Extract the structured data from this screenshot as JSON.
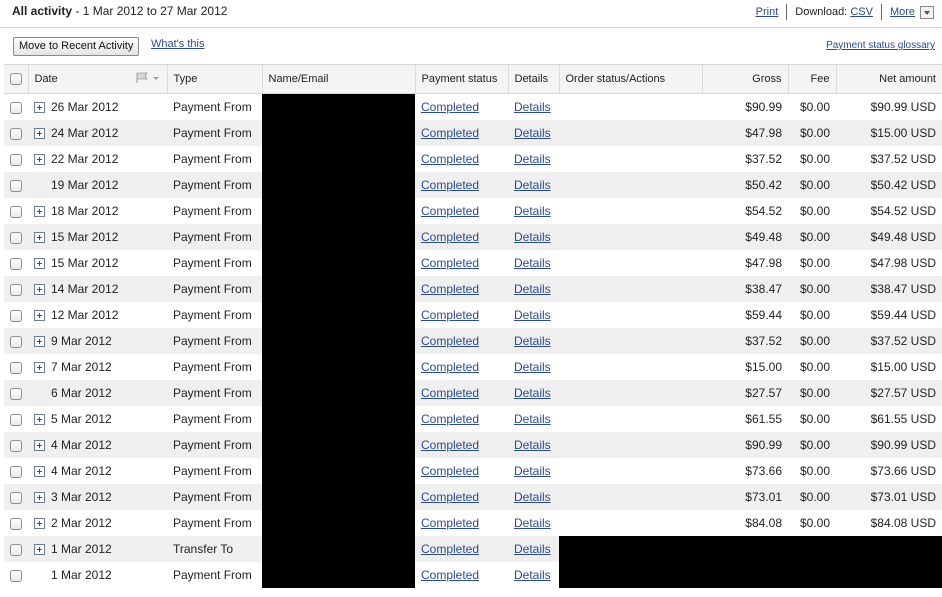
{
  "header": {
    "title_bold": "All activity",
    "title_range": " - 1 Mar 2012 to 27 Mar 2012",
    "print": "Print",
    "download_label": "Download:",
    "csv": "CSV",
    "more": "More"
  },
  "toolbar": {
    "move_button": "Move to Recent Activity",
    "whats_this": "What's this",
    "glossary": "Payment status glossary"
  },
  "columns": {
    "date": "Date",
    "type": "Type",
    "name": "Name/Email",
    "status": "Payment status",
    "details": "Details",
    "order": "Order status/Actions",
    "gross": "Gross",
    "fee": "Fee",
    "net": "Net amount"
  },
  "rows": [
    {
      "date": "26 Mar 2012",
      "expand": true,
      "type": "Payment From",
      "status": "Completed",
      "details": "Details",
      "gross": "$90.99",
      "fee": "$0.00",
      "net": "$90.99 USD"
    },
    {
      "date": "24 Mar 2012",
      "expand": true,
      "type": "Payment From",
      "status": "Completed",
      "details": "Details",
      "gross": "$47.98",
      "fee": "$0.00",
      "net": "$15.00 USD"
    },
    {
      "date": "22 Mar 2012",
      "expand": true,
      "type": "Payment From",
      "status": "Completed",
      "details": "Details",
      "gross": "$37.52",
      "fee": "$0.00",
      "net": "$37.52 USD"
    },
    {
      "date": "19 Mar 2012",
      "expand": false,
      "type": "Payment From",
      "status": "Completed",
      "details": "Details",
      "gross": "$50.42",
      "fee": "$0.00",
      "net": "$50.42 USD"
    },
    {
      "date": "18 Mar 2012",
      "expand": true,
      "type": "Payment From",
      "status": "Completed",
      "details": "Details",
      "gross": "$54.52",
      "fee": "$0.00",
      "net": "$54.52 USD"
    },
    {
      "date": "15 Mar 2012",
      "expand": true,
      "type": "Payment From",
      "status": "Completed",
      "details": "Details",
      "gross": "$49.48",
      "fee": "$0.00",
      "net": "$49.48 USD"
    },
    {
      "date": "15 Mar 2012",
      "expand": true,
      "type": "Payment From",
      "status": "Completed",
      "details": "Details",
      "gross": "$47.98",
      "fee": "$0.00",
      "net": "$47.98 USD"
    },
    {
      "date": "14 Mar 2012",
      "expand": true,
      "type": "Payment From",
      "status": "Completed",
      "details": "Details",
      "gross": "$38.47",
      "fee": "$0.00",
      "net": "$38.47 USD"
    },
    {
      "date": "12 Mar 2012",
      "expand": true,
      "type": "Payment From",
      "status": "Completed",
      "details": "Details",
      "gross": "$59.44",
      "fee": "$0.00",
      "net": "$59.44 USD"
    },
    {
      "date": "9 Mar 2012",
      "expand": true,
      "type": "Payment From",
      "status": "Completed",
      "details": "Details",
      "gross": "$37.52",
      "fee": "$0.00",
      "net": "$37.52 USD"
    },
    {
      "date": "7 Mar 2012",
      "expand": true,
      "type": "Payment From",
      "status": "Completed",
      "details": "Details",
      "gross": "$15.00",
      "fee": "$0.00",
      "net": "$15.00 USD"
    },
    {
      "date": "6 Mar 2012",
      "expand": false,
      "type": "Payment From",
      "status": "Completed",
      "details": "Details",
      "gross": "$27.57",
      "fee": "$0.00",
      "net": "$27.57 USD"
    },
    {
      "date": "5 Mar 2012",
      "expand": true,
      "type": "Payment From",
      "status": "Completed",
      "details": "Details",
      "gross": "$61.55",
      "fee": "$0.00",
      "net": "$61.55 USD"
    },
    {
      "date": "4 Mar 2012",
      "expand": true,
      "type": "Payment From",
      "status": "Completed",
      "details": "Details",
      "gross": "$90.99",
      "fee": "$0.00",
      "net": "$90.99 USD"
    },
    {
      "date": "4 Mar 2012",
      "expand": true,
      "type": "Payment From",
      "status": "Completed",
      "details": "Details",
      "gross": "$73.66",
      "fee": "$0.00",
      "net": "$73.66 USD"
    },
    {
      "date": "3 Mar 2012",
      "expand": true,
      "type": "Payment From",
      "status": "Completed",
      "details": "Details",
      "gross": "$73.01",
      "fee": "$0.00",
      "net": "$73.01 USD"
    },
    {
      "date": "2 Mar 2012",
      "expand": true,
      "type": "Payment From",
      "status": "Completed",
      "details": "Details",
      "gross": "$84.08",
      "fee": "$0.00",
      "net": "$84.08 USD"
    },
    {
      "date": "1 Mar 2012",
      "expand": true,
      "type": "Transfer To",
      "status": "Completed",
      "details": "Details",
      "gross": "",
      "fee": "",
      "net": "",
      "redact_amounts": true
    },
    {
      "date": "1 Mar 2012",
      "expand": false,
      "type": "Payment From",
      "status": "Completed",
      "details": "Details",
      "gross": "",
      "fee": "",
      "net": "",
      "redact_amounts": true
    }
  ]
}
